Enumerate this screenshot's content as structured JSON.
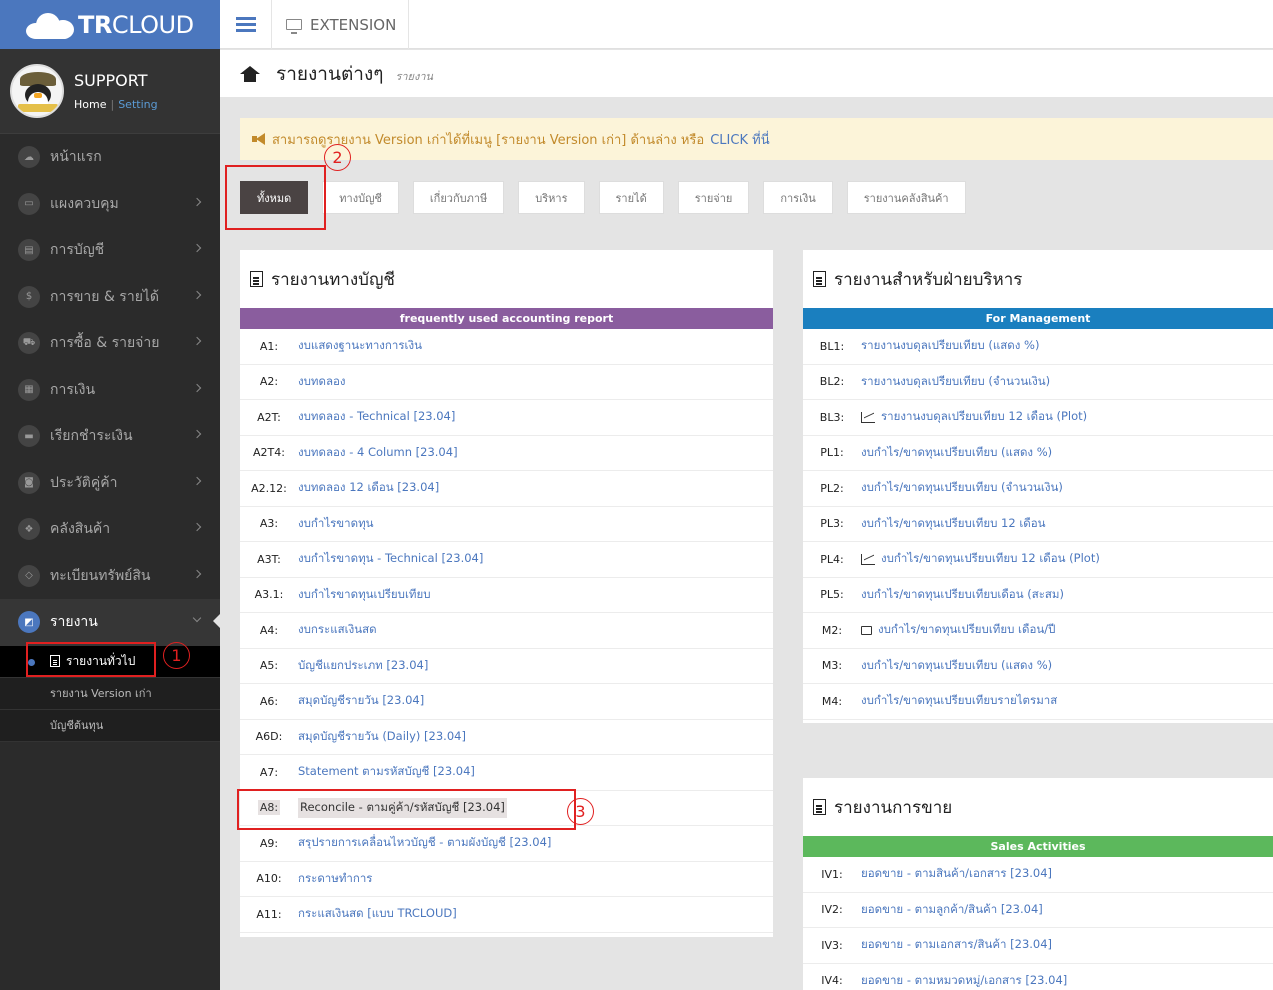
{
  "brand": {
    "logo_bold": "TR",
    "logo_rest": "CLOUD"
  },
  "profile": {
    "name": "SUPPORT",
    "home_link": "Home",
    "separator": "|",
    "setting_link": "Setting"
  },
  "sidebar": {
    "items": [
      {
        "label": "หน้าแรก",
        "icon": "cloud-icon"
      },
      {
        "label": "แผงควบคุม",
        "icon": "monitor-icon"
      },
      {
        "label": "การบัญชี",
        "icon": "book-icon"
      },
      {
        "label": "การขาย & รายได้",
        "icon": "dollar-icon"
      },
      {
        "label": "การซื้อ & รายจ่าย",
        "icon": "cart-icon"
      },
      {
        "label": "การเงิน",
        "icon": "calendar-icon"
      },
      {
        "label": "เรียกชำระเงิน",
        "icon": "card-icon"
      },
      {
        "label": "ประวัติคู่ค้า",
        "icon": "contact-icon"
      },
      {
        "label": "คลังสินค้า",
        "icon": "boxes-icon"
      },
      {
        "label": "ทะเบียนทรัพย์สิน",
        "icon": "diamond-icon"
      },
      {
        "label": "รายงาน",
        "icon": "report-icon"
      }
    ],
    "submenu": [
      {
        "label": "รายงานทั่วไป"
      },
      {
        "label": "รายงาน Version เก่า"
      },
      {
        "label": "บัญชีต้นทุน"
      }
    ]
  },
  "topbar": {
    "extension_label": "EXTENSION"
  },
  "page": {
    "title": "รายงานต่างๆ",
    "subtitle": "รายงาน"
  },
  "notice": {
    "text": "สามารถดูรายงาน Version เก่าได้ที่เมนู [รายงาน Version เก่า] ด้านล่าง หรือ",
    "click_label": "CLICK ที่นี่"
  },
  "tabs": [
    "ทั้งหมด",
    "ทางบัญชี",
    "เกี่ยวกับภาษี",
    "บริหาร",
    "รายได้",
    "รายจ่าย",
    "การเงิน",
    "รายงานคลังสินค้า"
  ],
  "accounting_panel": {
    "title": "รายงานทางบัญชี",
    "header": "frequently used accounting report",
    "header_color": "#8a5d9e",
    "rows": [
      {
        "code": "A1:",
        "label": "งบแสดงฐานะทางการเงิน"
      },
      {
        "code": "A2:",
        "label": "งบทดลอง"
      },
      {
        "code": "A2T:",
        "label": "งบทดลอง - Technical [23.04]"
      },
      {
        "code": "A2T4:",
        "label": "งบทดลอง - 4 Column [23.04]"
      },
      {
        "code": "A2.12:",
        "label": "งบทดลอง 12 เดือน [23.04]"
      },
      {
        "code": "A3:",
        "label": "งบกำไรขาดทุน"
      },
      {
        "code": "A3T:",
        "label": "งบกำไรขาดทุน - Technical [23.04]"
      },
      {
        "code": "A3.1:",
        "label": "งบกำไรขาดทุนเปรียบเทียบ"
      },
      {
        "code": "A4:",
        "label": "งบกระแสเงินสด"
      },
      {
        "code": "A5:",
        "label": "บัญชีแยกประเภท [23.04]"
      },
      {
        "code": "A6:",
        "label": "สมุดบัญชีรายวัน [23.04]"
      },
      {
        "code": "A6D:",
        "label": "สมุดบัญชีรายวัน (Daily) [23.04]"
      },
      {
        "code": "A7:",
        "label": "Statement ตามรหัสบัญชี [23.04]"
      },
      {
        "code": "A8:",
        "label": "Reconcile - ตามคู่ค้า/รหัสบัญชี [23.04]"
      },
      {
        "code": "A9:",
        "label": "สรุปรายการเคลื่อนไหวบัญชี - ตามผังบัญชี [23.04]"
      },
      {
        "code": "A10:",
        "label": "กระดาษทำการ"
      },
      {
        "code": "A11:",
        "label": "กระแสเงินสด [แบบ TRCLOUD]"
      }
    ]
  },
  "management_panel": {
    "title": "รายงานสำหรับฝ่ายบริหาร",
    "header": "For Management",
    "header_color": "#1a7fbf",
    "rows": [
      {
        "code": "BL1:",
        "label": "รายงานงบดุลเปรียบเทียบ (แสดง %)",
        "icon": ""
      },
      {
        "code": "BL2:",
        "label": "รายงานงบดุลเปรียบเทียบ (จำนวนเงิน)",
        "icon": ""
      },
      {
        "code": "BL3:",
        "label": "รายงานงบดุลเปรียบเทียบ 12 เดือน (Plot)",
        "icon": "chart"
      },
      {
        "code": "PL1:",
        "label": "งบกำไร/ขาดทุนเปรียบเทียบ (แสดง %)",
        "icon": ""
      },
      {
        "code": "PL2:",
        "label": "งบกำไร/ขาดทุนเปรียบเทียบ (จำนวนเงิน)",
        "icon": ""
      },
      {
        "code": "PL3:",
        "label": "งบกำไร/ขาดทุนเปรียบเทียบ 12 เดือน",
        "icon": ""
      },
      {
        "code": "PL4:",
        "label": "งบกำไร/ขาดทุนเปรียบเทียบ 12 เดือน (Plot)",
        "icon": "chart"
      },
      {
        "code": "PL5:",
        "label": "งบกำไร/ขาดทุนเปรียบเทียบเดือน (สะสม)",
        "icon": ""
      },
      {
        "code": "M2:",
        "label": "งบกำไร/ขาดทุนเปรียบเทียบ เดือน/ปี",
        "icon": "print"
      },
      {
        "code": "M3:",
        "label": "งบกำไร/ขาดทุนเปรียบเทียบ (แสดง %)",
        "icon": ""
      },
      {
        "code": "M4:",
        "label": "งบกำไร/ขาดทุนเปรียบเทียบรายไตรมาส",
        "icon": ""
      }
    ]
  },
  "sales_panel": {
    "title": "รายงานการขาย",
    "header": "Sales Activities",
    "header_color": "#5cb85c",
    "rows": [
      {
        "code": "IV1:",
        "label": "ยอดขาย - ตามสินค้า/เอกสาร [23.04]"
      },
      {
        "code": "IV2:",
        "label": "ยอดขาย - ตามลูกค้า/สินค้า [23.04]"
      },
      {
        "code": "IV3:",
        "label": "ยอดขาย - ตามเอกสาร/สินค้า [23.04]"
      },
      {
        "code": "IV4:",
        "label": "ยอดขาย - ตามหมวดหมู่/เอกสาร [23.04]"
      }
    ]
  },
  "annotations": [
    "1",
    "2",
    "3"
  ]
}
